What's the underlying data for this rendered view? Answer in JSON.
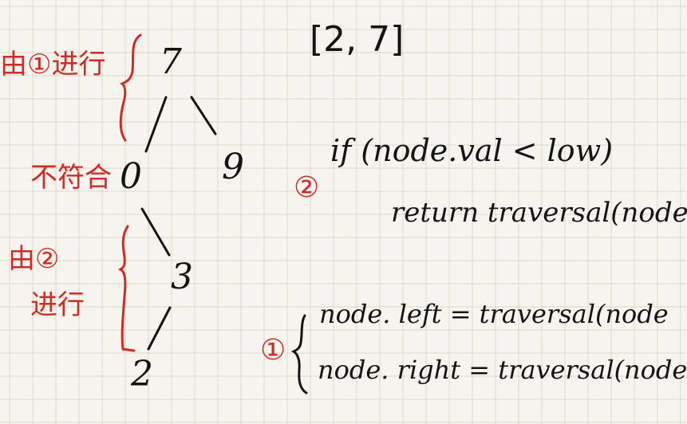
{
  "range": "[2, 7]",
  "tree": {
    "root": "7",
    "left": "0",
    "right": "9",
    "left_right": "3",
    "left_right_left": "2"
  },
  "annotations": {
    "step1_label": "由①进行",
    "mismatch_label": "不符合",
    "step2_label_line1": "由②",
    "step2_label_line2": "进行",
    "marker_1": "①",
    "marker_2": "②"
  },
  "code": {
    "if_line": "if (node.val < low)",
    "return_line": "return traversal(node",
    "left_assign": "node. left = traversal(node",
    "right_assign": "node. right = traversal(node"
  },
  "colors": {
    "paper": "#f6f4ee",
    "grid": "#dcd7c8",
    "ink": "#141414",
    "red": "#d42a26"
  }
}
